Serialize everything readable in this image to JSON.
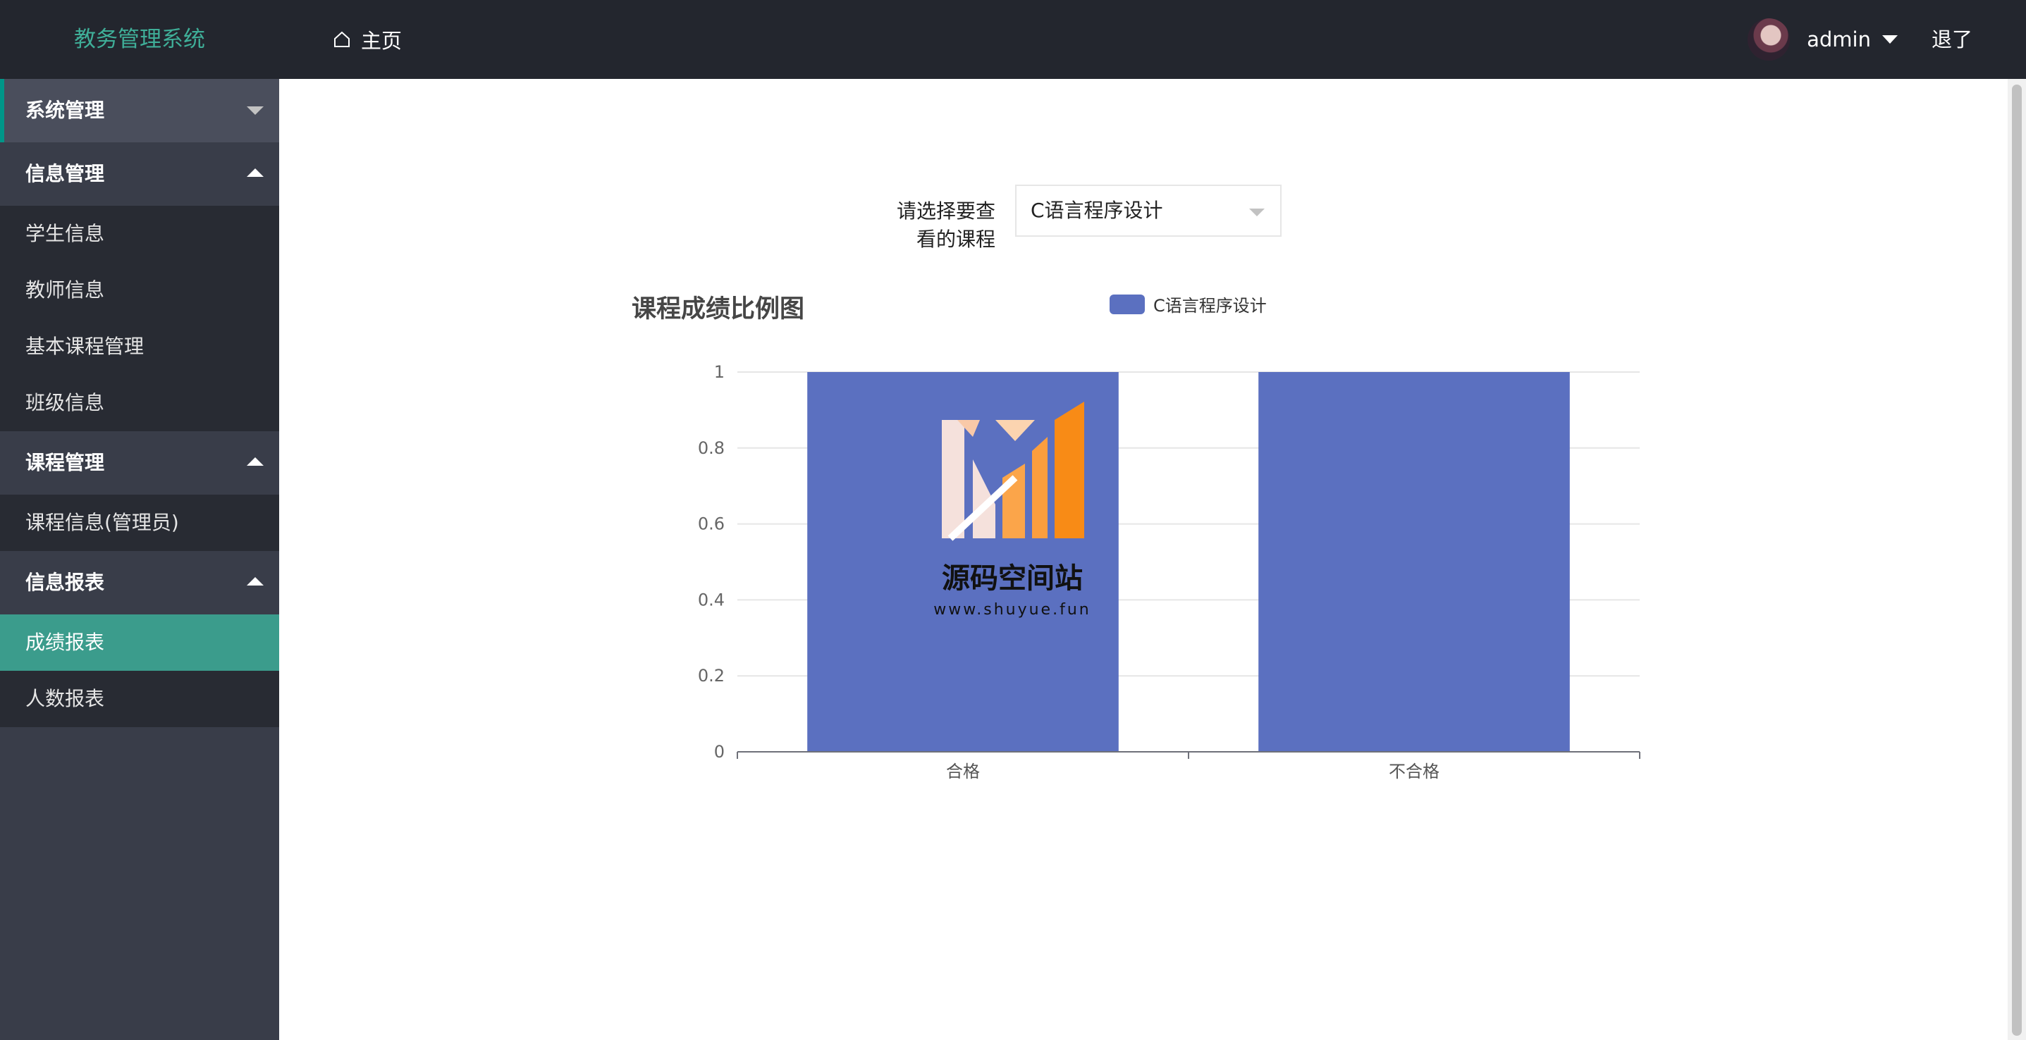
{
  "header": {
    "brand": "教务管理系统",
    "home_label": "主页",
    "user_name": "admin",
    "logout_label": "退了"
  },
  "sidebar": {
    "groups": [
      {
        "title": "系统管理",
        "expanded": false,
        "items": []
      },
      {
        "title": "信息管理",
        "expanded": true,
        "items": [
          "学生信息",
          "教师信息",
          "基本课程管理",
          "班级信息"
        ]
      },
      {
        "title": "课程管理",
        "expanded": true,
        "items": [
          "课程信息(管理员)"
        ]
      },
      {
        "title": "信息报表",
        "expanded": true,
        "items": [
          "成绩报表",
          "人数报表"
        ]
      }
    ],
    "selected_item": "成绩报表"
  },
  "filter": {
    "label": "请选择要查看的课程",
    "label_line1": "请选择要查",
    "label_line2": "看的课程",
    "selected_course": "C语言程序设计"
  },
  "watermark": {
    "name": "源码空间站",
    "url": "www.shuyue.fun"
  },
  "colors": {
    "brand": "#3fae98",
    "accent": "#009688",
    "bar": "#5b70c0",
    "topbar": "#23262e",
    "sidebar": "#393d49",
    "sidebar_child": "#282b33"
  },
  "chart_data": {
    "type": "bar",
    "title": "课程成绩比例图",
    "categories": [
      "合格",
      "不合格"
    ],
    "series": [
      {
        "name": "C语言程序设计",
        "values": [
          1,
          1
        ]
      }
    ],
    "ylim": [
      0,
      1
    ],
    "yticks": [
      0,
      0.2,
      0.4,
      0.6,
      0.8,
      1
    ],
    "ytick_labels": [
      "0",
      "0.2",
      "0.4",
      "0.6",
      "0.8",
      "1"
    ],
    "grid": true,
    "legend": "top-center"
  }
}
